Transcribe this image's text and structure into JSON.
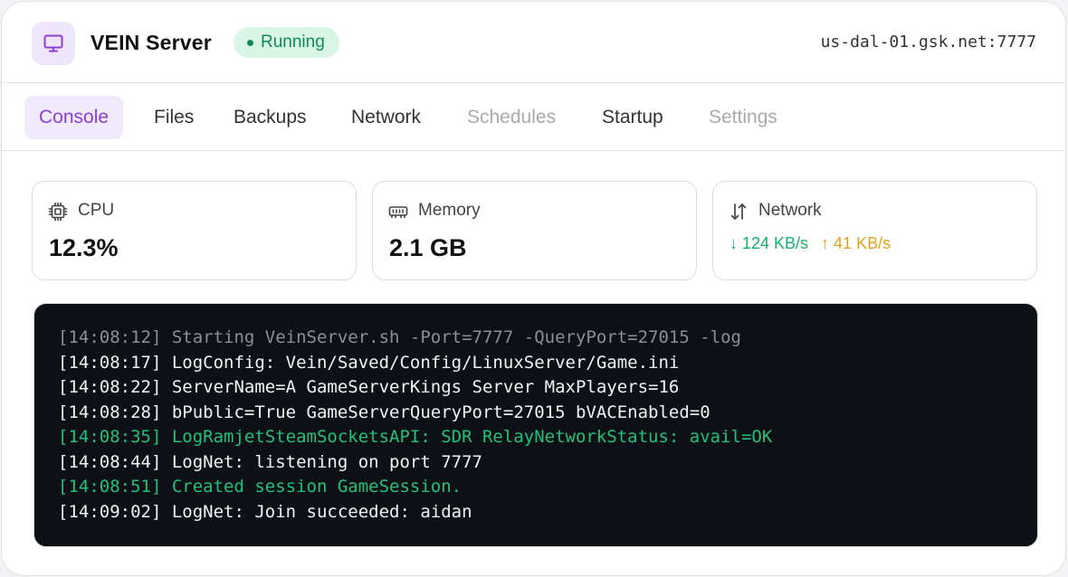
{
  "server": {
    "name": "VEIN Server",
    "status": "Running",
    "host": "us-dal-01.gsk.net:7777",
    "icon": "monitor-icon"
  },
  "tabs": [
    {
      "label": "Console",
      "state": "active"
    },
    {
      "label": "Files",
      "state": "normal"
    },
    {
      "label": "Backups",
      "state": "normal"
    },
    {
      "label": "Network",
      "state": "normal"
    },
    {
      "label": "Schedules",
      "state": "disabled"
    },
    {
      "label": "Startup",
      "state": "normal"
    },
    {
      "label": "Settings",
      "state": "disabled"
    }
  ],
  "stats": {
    "cpu": {
      "label": "CPU",
      "value": "12.3%",
      "icon": "cpu-icon"
    },
    "memory": {
      "label": "Memory",
      "value": "2.1 GB",
      "icon": "memory-icon"
    },
    "network": {
      "label": "Network",
      "down": "↓ 124 KB/s",
      "up": "↑ 41 KB/s",
      "icon": "arrows-up-down-icon"
    }
  },
  "console": {
    "lines": [
      {
        "text": "[14:08:12] Starting VeinServer.sh -Port=7777 -QueryPort=27015 -log",
        "style": "dim"
      },
      {
        "text": "[14:08:17] LogConfig: Vein/Saved/Config/LinuxServer/Game.ini",
        "style": "normal"
      },
      {
        "text": "[14:08:22] ServerName=A GameServerKings Server MaxPlayers=16",
        "style": "normal"
      },
      {
        "text": "[14:08:28] bPublic=True GameServerQueryPort=27015 bVACEnabled=0",
        "style": "normal"
      },
      {
        "text": "[14:08:35] LogRamjetSteamSocketsAPI: SDR RelayNetworkStatus: avail=OK",
        "style": "ok"
      },
      {
        "text": "[14:08:44] LogNet: listening on port 7777",
        "style": "normal"
      },
      {
        "text": "[14:08:51] Created session GameSession.",
        "style": "ok"
      },
      {
        "text": "[14:09:02] LogNet: Join succeeded: aidan",
        "style": "normal"
      }
    ]
  },
  "colors": {
    "accent": "#8a3fd6",
    "status_green": "#0f8a52",
    "rate_down": "#12b06a",
    "rate_up": "#e0a21a",
    "console_bg": "#0d1117"
  }
}
